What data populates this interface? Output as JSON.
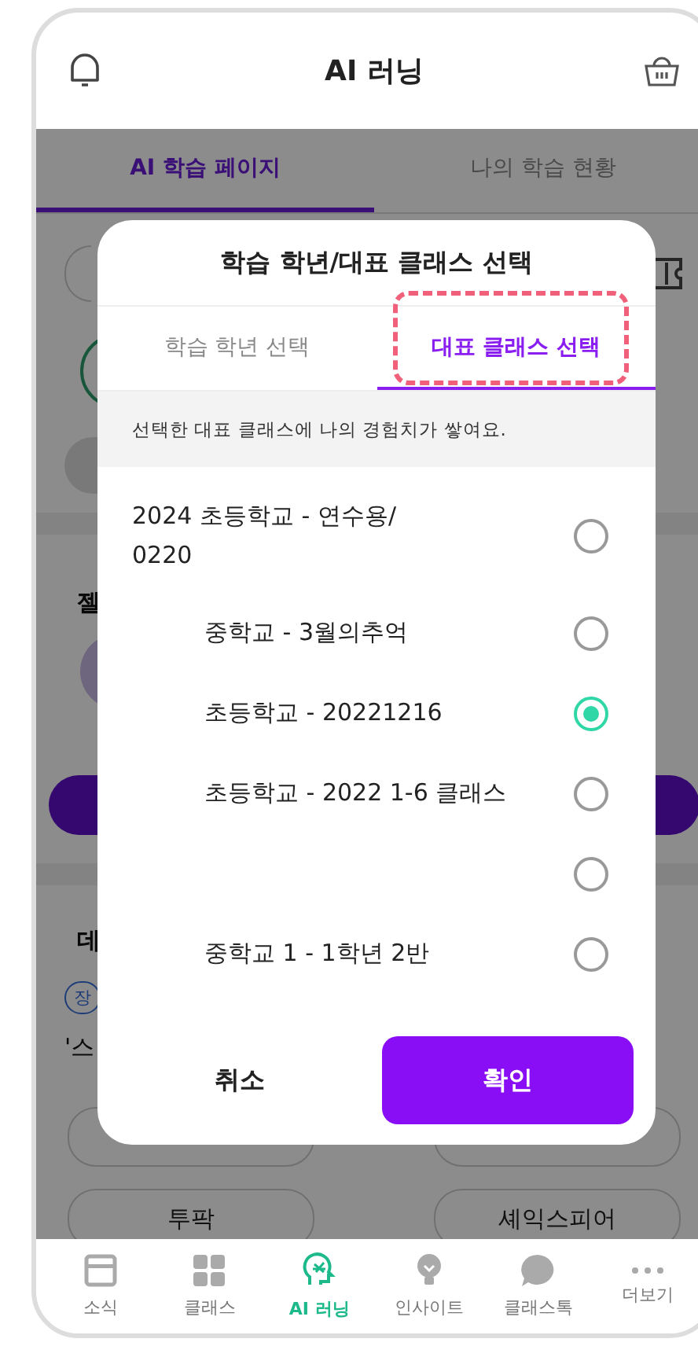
{
  "header": {
    "title": "AI 러닝"
  },
  "page_tabs": [
    {
      "label": "AI 학습 페이지",
      "selected": true
    },
    {
      "label": "나의 학습 현황",
      "selected": false
    }
  ],
  "background": {
    "section_1_heading": "젤",
    "section_2_heading": "데",
    "chip": "장",
    "section_2_text": "'스",
    "pills": [
      "투팍",
      "셰익스피어"
    ]
  },
  "dialog": {
    "title": "학습 학년/대표 클래스 선택",
    "tabs": [
      {
        "label": "학습 학년 선택",
        "selected": false
      },
      {
        "label": "대표 클래스 선택",
        "selected": true
      }
    ],
    "info": "선택한 대표 클래스에 나의 경험치가 쌓여요.",
    "options": [
      {
        "kind": "wide",
        "label": "2024 초등학교 - 연수용/0220",
        "selected": false
      },
      {
        "kind": "indented",
        "label": "중학교 - 3월의추억",
        "selected": false
      },
      {
        "kind": "indented",
        "label": "초등학교 - 20221216",
        "selected": true
      },
      {
        "kind": "indented",
        "label": "초등학교 - 2022 1-6 클래스",
        "selected": false
      },
      {
        "kind": "indented",
        "selected": false
      },
      {
        "kind": "indented",
        "label": "중학교 1 - 1학년 2반",
        "selected": false
      }
    ],
    "cancel": "취소",
    "confirm": "확인"
  },
  "bottom_nav": [
    {
      "kind": "news",
      "label": "소식",
      "selected": false
    },
    {
      "kind": "class",
      "label": "클래스",
      "selected": false
    },
    {
      "kind": "ai",
      "label": "AI 러닝",
      "selected": true
    },
    {
      "kind": "insight",
      "label": "인사이트",
      "selected": false
    },
    {
      "kind": "talk",
      "label": "클래스톡",
      "selected": false
    },
    {
      "kind": "more",
      "label": "더보기",
      "selected": false
    }
  ]
}
